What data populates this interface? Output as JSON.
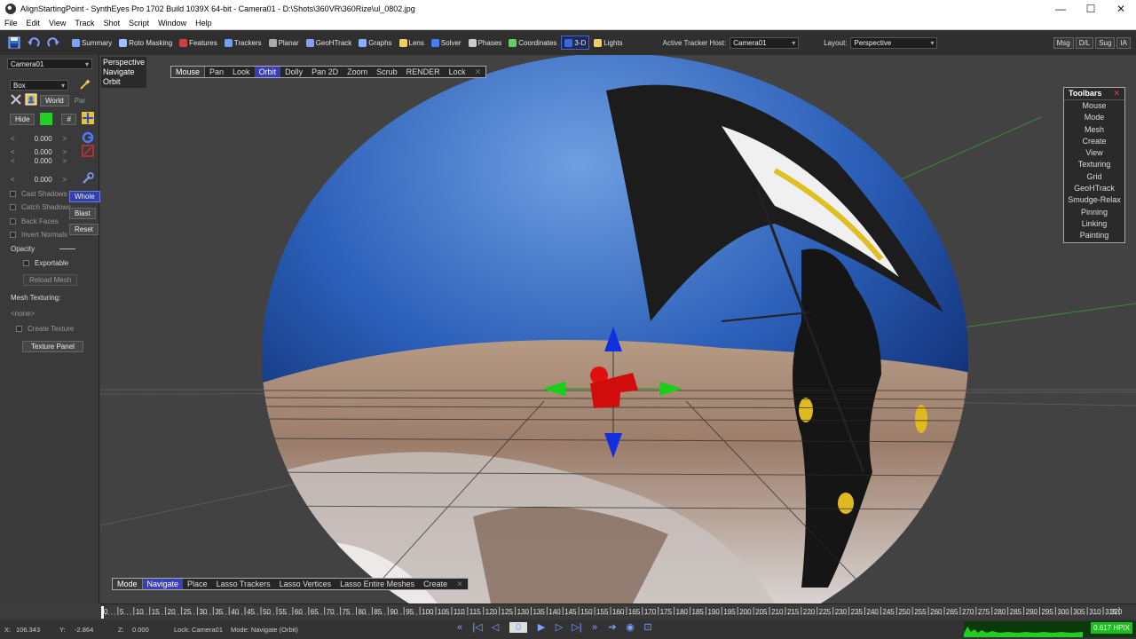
{
  "window": {
    "title": "AlignStartingPoint - SynthEyes Pro 1702 Build 1039X 64-bit - Camera01 - D:\\Shots\\360VR\\360Rize\\ul_0802.jpg",
    "minimize": "—",
    "maximize": "☐",
    "close": "✕"
  },
  "menu": [
    "File",
    "Edit",
    "View",
    "Track",
    "Shot",
    "Script",
    "Window",
    "Help"
  ],
  "toolbar": {
    "rooms": [
      {
        "label": "Summary",
        "icon": "sigma-icon"
      },
      {
        "label": "Roto Masking",
        "icon": "roto-icon"
      },
      {
        "label": "Features",
        "icon": "features-icon"
      },
      {
        "label": "Trackers",
        "icon": "trackers-icon"
      },
      {
        "label": "Planar",
        "icon": "planar-icon"
      },
      {
        "label": "GeoHTrack",
        "icon": "geohtrack-icon"
      },
      {
        "label": "Graphs",
        "icon": "graphs-icon"
      },
      {
        "label": "Lens",
        "icon": "lens-icon"
      },
      {
        "label": "Solver",
        "icon": "solver-icon"
      },
      {
        "label": "Phases",
        "icon": "phases-icon"
      },
      {
        "label": "Coordinates",
        "icon": "coordinates-icon"
      },
      {
        "label": "3-D",
        "icon": "3d-icon"
      },
      {
        "label": "Lights",
        "icon": "lights-icon"
      }
    ],
    "active_room": "3-D",
    "active_tracker_host_label": "Active Tracker Host:",
    "active_tracker_host_value": "Camera01",
    "layout_label": "Layout:",
    "layout_value": "Perspective",
    "right_buttons": [
      "Msg",
      "D/L",
      "Sug",
      "IA"
    ]
  },
  "left_panel": {
    "object_select": "Camera01",
    "mesh_type": "Box",
    "world_label": "World",
    "par_label": "Par",
    "hide_label": "Hide",
    "hash_label": "#",
    "values": [
      "0.000",
      "0.000",
      "0.000",
      "0.000"
    ],
    "checks": [
      "Cast Shadows",
      "Catch Shadows",
      "Back Faces",
      "Invert Normals"
    ],
    "whole_label": "Whole",
    "blast_label": "Blast",
    "reset_label": "Reset",
    "opacity_label": "Opacity",
    "exportable_label": "Exportable",
    "reload_mesh_label": "Reload Mesh",
    "mesh_texturing_label": "Mesh Texturing:",
    "none_label": "<none>",
    "create_texture_label": "Create Texture",
    "texture_panel_label": "Texture Panel"
  },
  "viewport": {
    "info_lines": [
      "Perspective",
      "Navigate",
      "Orbit"
    ],
    "mouse_bar": [
      "Mouse",
      "Pan",
      "Look",
      "Orbit",
      "Dolly",
      "Pan 2D",
      "Zoom",
      "Scrub",
      "RENDER",
      "Lock"
    ],
    "mouse_bar_selected": "Orbit",
    "mode_bar": [
      "Mode",
      "Navigate",
      "Place",
      "Lasso Trackers",
      "Lasso Vertices",
      "Lasso Entire Meshes",
      "Create"
    ],
    "mode_bar_selected": "Navigate",
    "bar_close": "✕"
  },
  "toolbars_panel": {
    "title": "Toolbars",
    "close": "✕",
    "items": [
      "Mouse",
      "Mode",
      "Mesh",
      "Create",
      "View",
      "Texturing",
      "Grid",
      "GeoHTrack",
      "Smudge-Relax",
      "Pinning",
      "Linking",
      "Painting"
    ]
  },
  "timeline": {
    "start": 0,
    "end": 320,
    "step": 5,
    "last_label": "320"
  },
  "status": {
    "x_label": "X:",
    "x_value": "106.343",
    "y_label": "Y:",
    "y_value": "-2.864",
    "z_label": "Z:",
    "z_value": "0.000",
    "lock": "Lock: Camera01",
    "mode": "Mode: Navigate (Orbit)",
    "frame": "0",
    "hpix": "0.617 HPIX"
  },
  "colors": {
    "accent_blue": "#3a3fb8",
    "gizmo_red": "#e01010",
    "gizmo_green": "#18d018",
    "gizmo_blue": "#1030e0",
    "hpix_green": "#22bb22"
  }
}
